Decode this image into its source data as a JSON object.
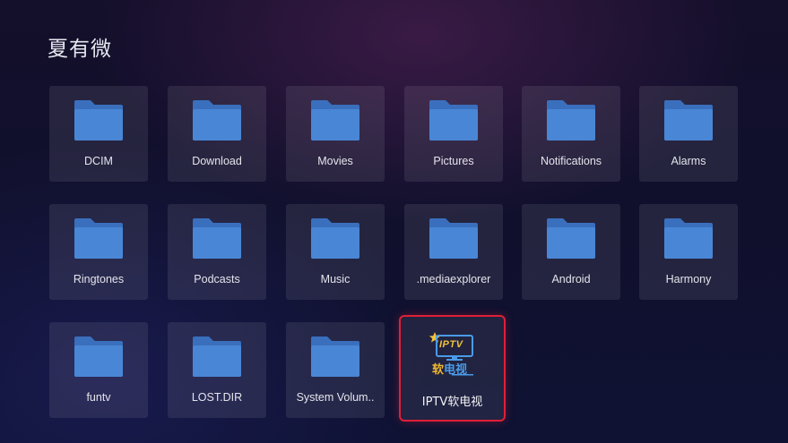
{
  "header": {
    "title": "夏有微"
  },
  "folders": [
    {
      "label": "DCIM",
      "icon": "folder-icon"
    },
    {
      "label": "Download",
      "icon": "folder-icon"
    },
    {
      "label": "Movies",
      "icon": "folder-icon"
    },
    {
      "label": "Pictures",
      "icon": "folder-icon"
    },
    {
      "label": "Notifications",
      "icon": "folder-icon"
    },
    {
      "label": "Alarms",
      "icon": "folder-icon"
    },
    {
      "label": "Ringtones",
      "icon": "folder-icon"
    },
    {
      "label": "Podcasts",
      "icon": "folder-icon"
    },
    {
      "label": "Music",
      "icon": "folder-icon"
    },
    {
      "label": ".mediaexplorer",
      "icon": "folder-icon"
    },
    {
      "label": "Android",
      "icon": "folder-icon"
    },
    {
      "label": "Harmony",
      "icon": "folder-icon"
    },
    {
      "label": "funtv",
      "icon": "folder-icon"
    },
    {
      "label": "LOST.DIR",
      "icon": "folder-icon"
    },
    {
      "label": "System Volum..",
      "icon": "folder-icon"
    }
  ],
  "app": {
    "label": "IPTV软电视",
    "icon": "iptv-app-icon",
    "icon_text_top": "IPTV",
    "icon_text_bottom_1": "软",
    "icon_text_bottom_2": "电视",
    "focused": true
  },
  "colors": {
    "folder": "#4a86d6",
    "folder_dark": "#3a6fbd",
    "focus_border": "#e11f37",
    "icon_gold": "#f0c23b",
    "icon_blue": "#4a9be8"
  }
}
